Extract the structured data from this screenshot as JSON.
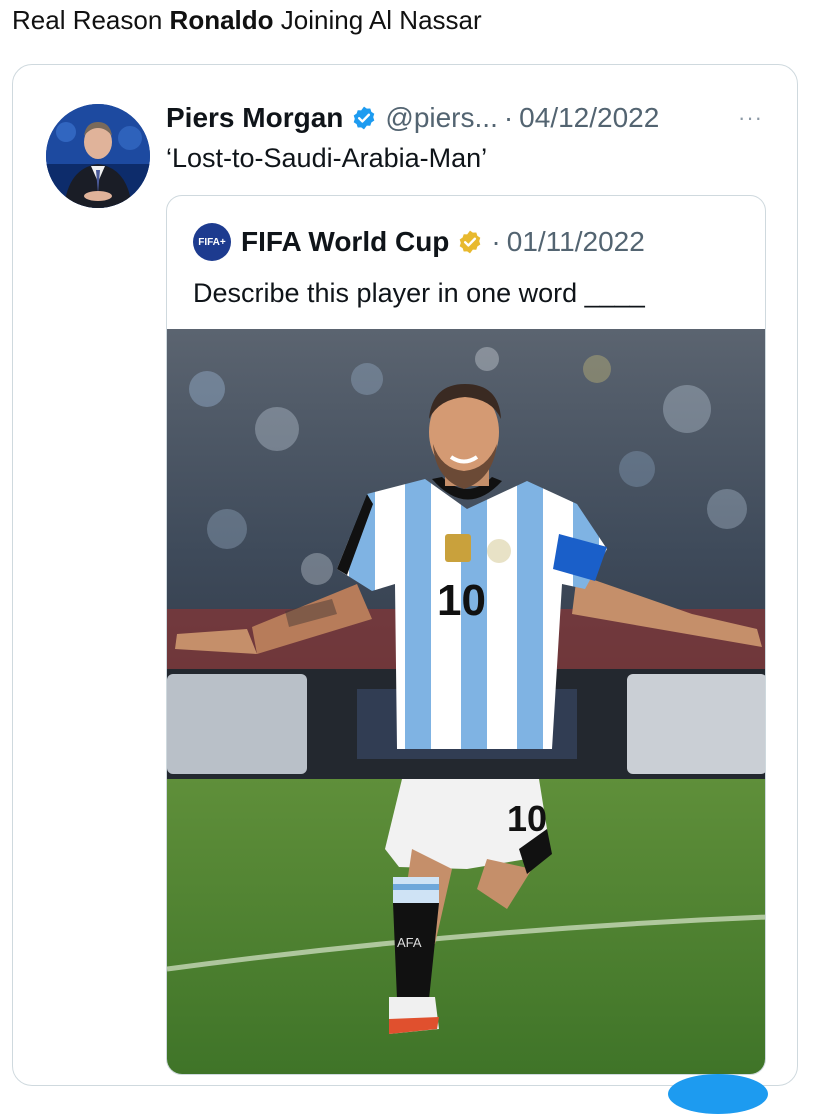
{
  "caption": {
    "prefix": "Real Reason ",
    "bold": "Ronaldo",
    "suffix": " Joining Al Nassar"
  },
  "tweet": {
    "author_name": "Piers Morgan",
    "handle": "@piers...",
    "separator": "·",
    "date": "04/12/2022",
    "more": "···",
    "text": "‘Lost-to-Saudi-Arabia-Man’",
    "verified_color": "#1d9bf0"
  },
  "quoted_tweet": {
    "logo_text": "FIFA+",
    "author_name": "FIFA World Cup",
    "separator": "·",
    "date": "01/11/2022",
    "text": "Describe this player in one word ____",
    "verified_color": "#e8b92e"
  },
  "photo": {
    "jersey_number": "10",
    "sock_text": "AFA"
  }
}
